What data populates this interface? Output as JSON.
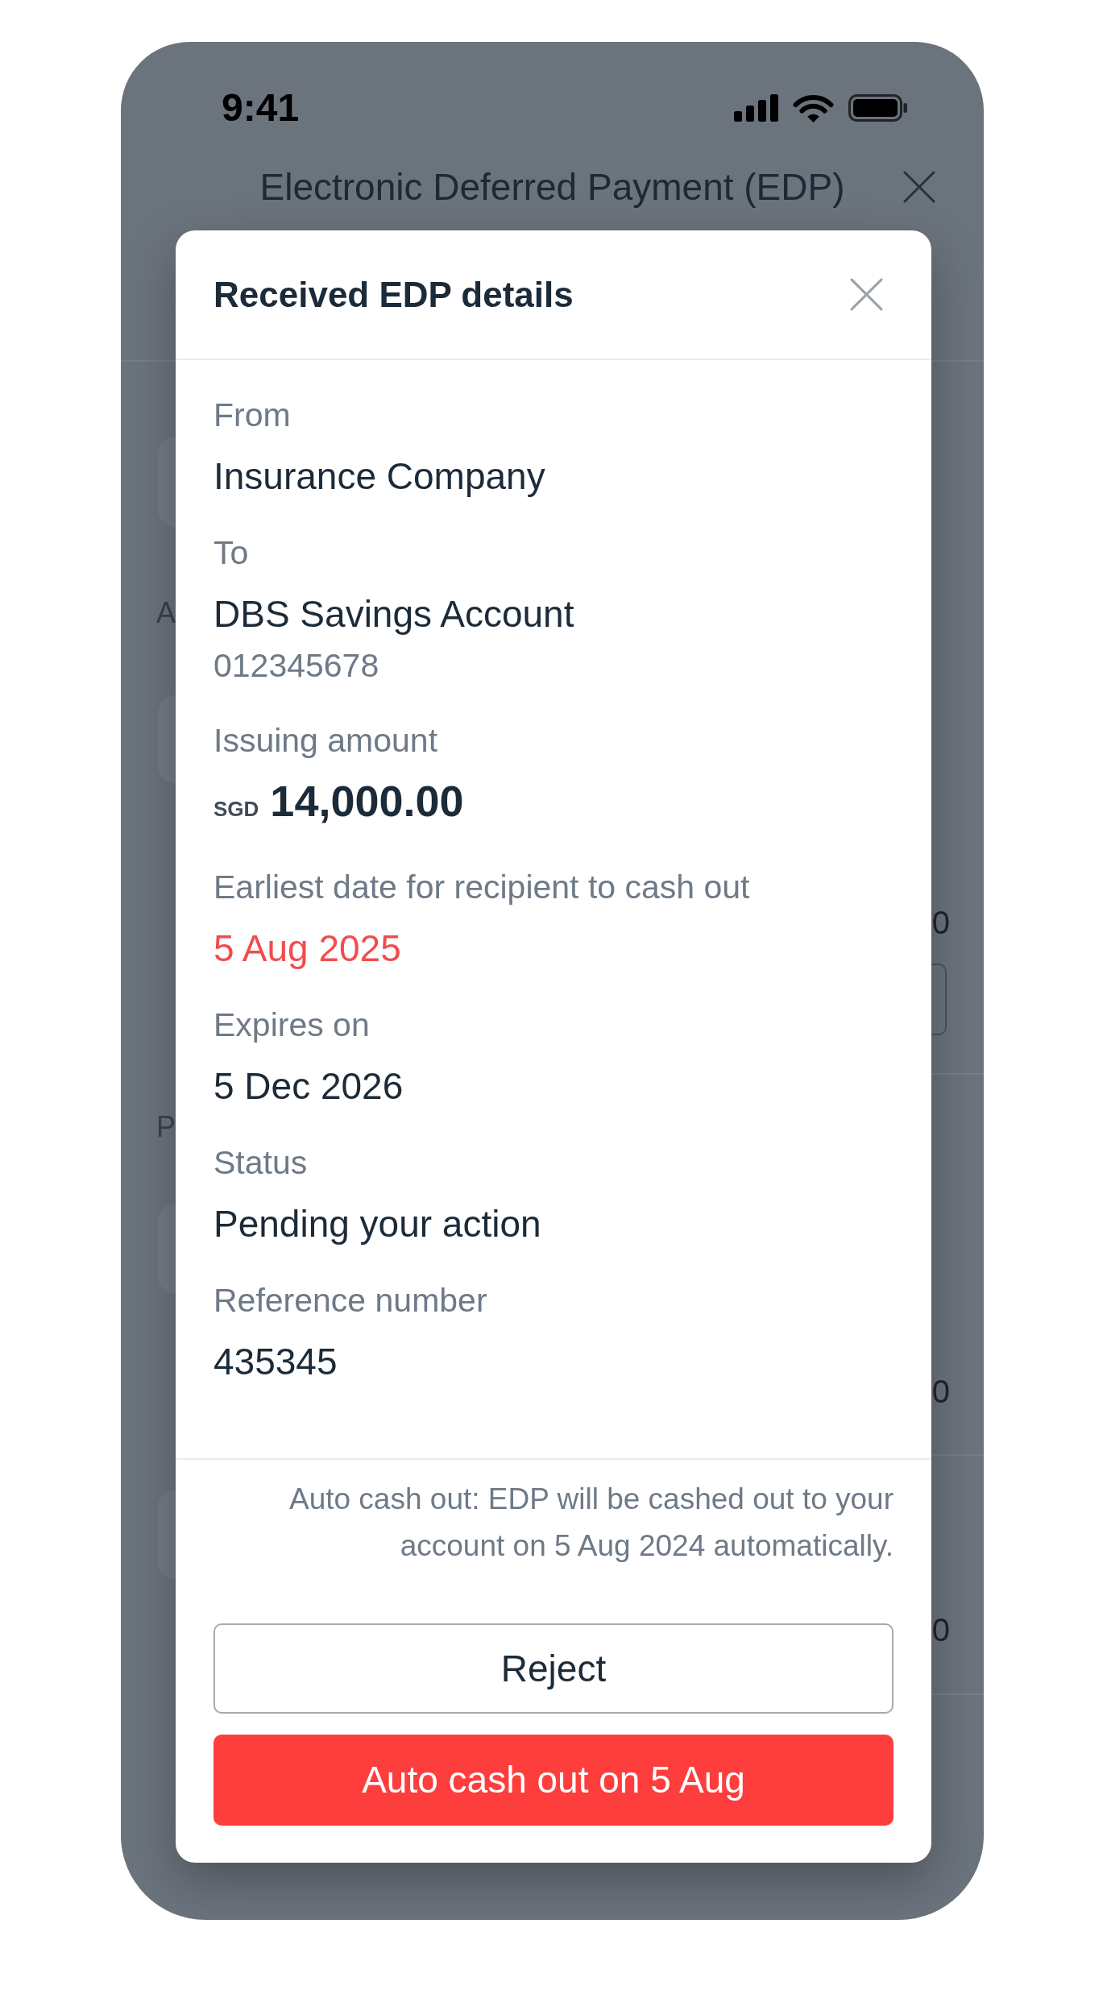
{
  "status_bar": {
    "time": "9:41"
  },
  "background_page": {
    "title": "Electronic Deferred Payment (EDP)",
    "left_texts": [
      "A",
      "P"
    ],
    "right_texts": [
      "0",
      "0",
      "0"
    ]
  },
  "dialog": {
    "title": "Received EDP details",
    "fields": [
      {
        "kind": "plain",
        "label": "From",
        "value": "Insurance Company"
      },
      {
        "kind": "plain",
        "label": "To",
        "value": "DBS Savings Account",
        "detail": "012345678"
      },
      {
        "kind": "amount",
        "label": "Issuing amount",
        "currency": "SGD",
        "value": "14,000.00"
      },
      {
        "kind": "alert",
        "label": "Earliest date for recipient to cash out",
        "value": "5 Aug 2025"
      },
      {
        "kind": "plain",
        "label": "Expires on",
        "value": "5 Dec 2026"
      },
      {
        "kind": "plain",
        "label": "Status",
        "value": "Pending your action"
      },
      {
        "kind": "plain",
        "label": "Reference number",
        "value": "435345"
      }
    ],
    "note": "Auto cash out: EDP will be cashed out to your account on 5 Aug 2024 automatically.",
    "buttons": [
      {
        "kind": "secondary",
        "label": "Reject"
      },
      {
        "kind": "primary",
        "label": "Auto cash out on 5 Aug"
      }
    ]
  }
}
